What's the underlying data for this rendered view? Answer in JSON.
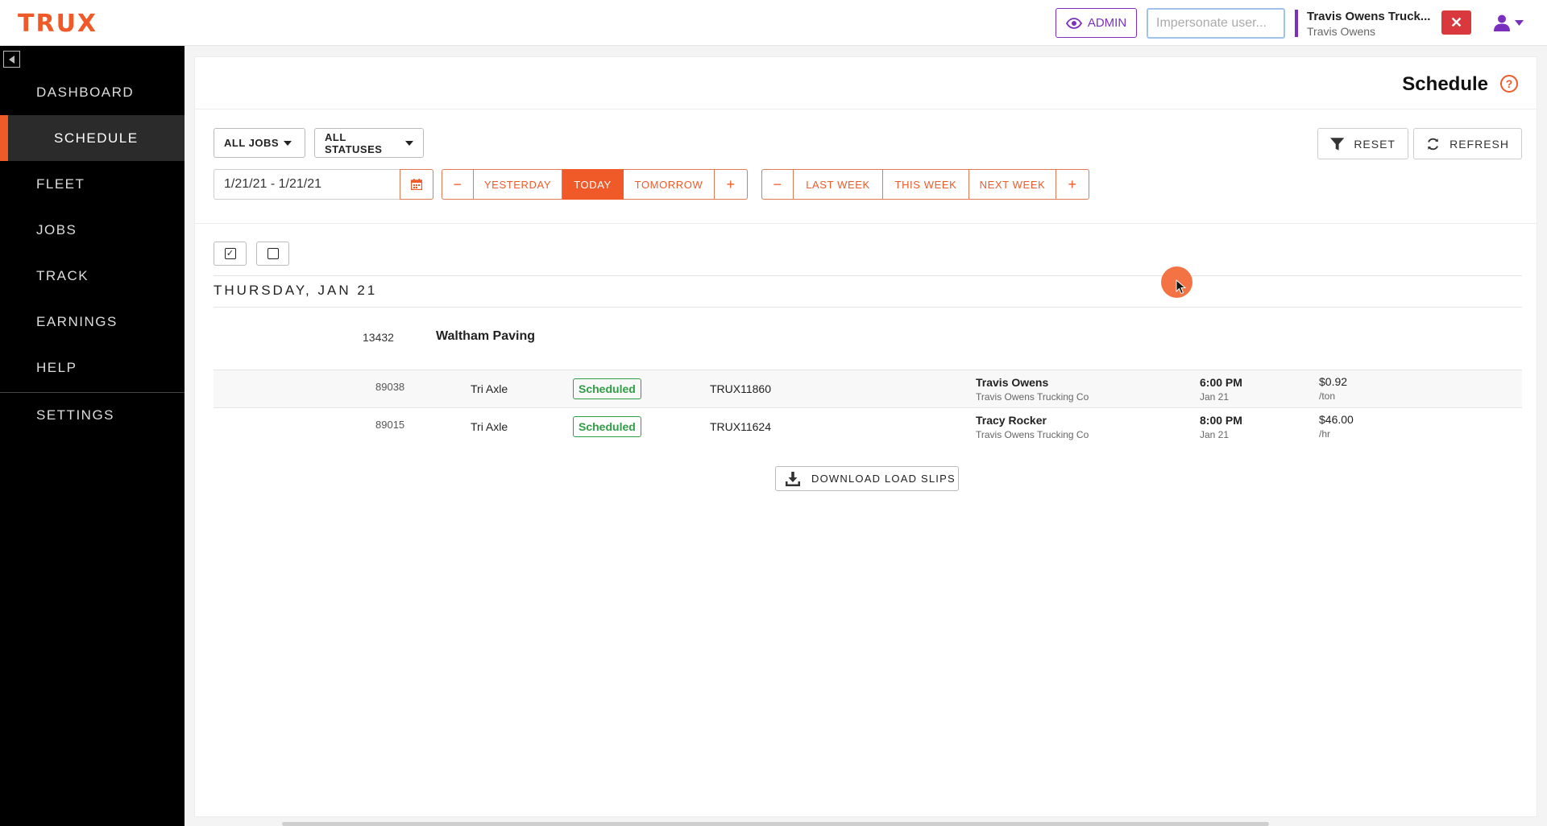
{
  "header": {
    "logo": "TRUX",
    "admin_label": "ADMIN",
    "impersonate_placeholder": "Impersonate user...",
    "account_name": "Travis Owens Truck...",
    "account_user": "Travis Owens",
    "close_glyph": "✕"
  },
  "sidebar": {
    "items": [
      {
        "label": "DASHBOARD"
      },
      {
        "label": "SCHEDULE"
      },
      {
        "label": "FLEET"
      },
      {
        "label": "JOBS"
      },
      {
        "label": "TRACK"
      },
      {
        "label": "EARNINGS"
      },
      {
        "label": "HELP"
      },
      {
        "label": "SETTINGS"
      }
    ],
    "active": "SCHEDULE"
  },
  "page": {
    "title": "Schedule",
    "help_glyph": "?"
  },
  "filters": {
    "jobs_dropdown": "ALL JOBS",
    "status_dropdown": "ALL STATUSES",
    "date_range": "1/21/21  -  1/21/21",
    "day_nav": {
      "minus": "−",
      "yesterday": "YESTERDAY",
      "today": "TODAY",
      "tomorrow": "TOMORROW",
      "plus": "+"
    },
    "week_nav": {
      "minus": "−",
      "last_week": "LAST WEEK",
      "this_week": "THIS WEEK",
      "next_week": "NEXT WEEK",
      "plus": "+"
    },
    "reset_label": "RESET",
    "refresh_label": "REFRESH"
  },
  "schedule": {
    "day_heading": "THURSDAY, JAN 21",
    "job": {
      "id": "13432",
      "name": "Waltham Paving"
    },
    "rows": [
      {
        "id": "89038",
        "truck_type": "Tri Axle",
        "status": "Scheduled",
        "truck_id": "TRUX11860",
        "driver": "Travis Owens",
        "company": "Travis Owens Trucking Co",
        "time": "6:00 PM",
        "date": "Jan 21",
        "rate": "$0.92",
        "unit": "/ton"
      },
      {
        "id": "89015",
        "truck_type": "Tri Axle",
        "status": "Scheduled",
        "truck_id": "TRUX11624",
        "driver": "Tracy Rocker",
        "company": "Travis Owens Trucking Co",
        "time": "8:00 PM",
        "date": "Jan 21",
        "rate": "$46.00",
        "unit": "/hr"
      }
    ],
    "download_label": "DOWNLOAD LOAD SLIPS"
  },
  "colors": {
    "brand": "#f05a28",
    "admin_purple": "#7b2fbf",
    "status_green": "#2f9e44",
    "close_red": "#d9383c"
  }
}
